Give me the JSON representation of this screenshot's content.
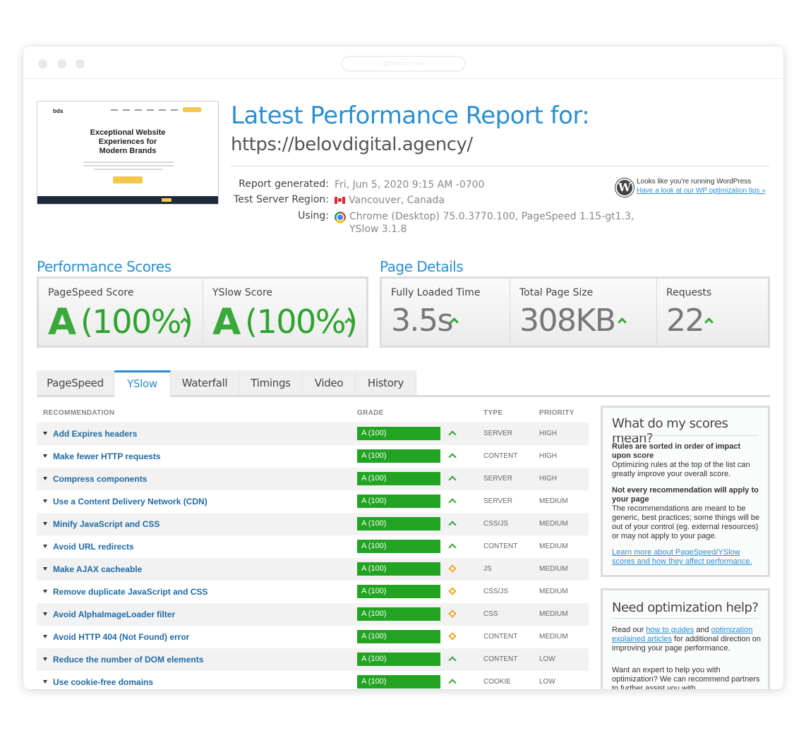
{
  "browser": {
    "url": "gtmetrix.com"
  },
  "thumbnail": {
    "logo": "bda",
    "headline": "Exceptional Website Experiences for Modern Brands"
  },
  "report": {
    "title": "Latest Performance Report for:",
    "url": "https://belovdigital.agency/",
    "generated_label": "Report generated:",
    "generated_value": "Fri, Jun 5, 2020 9:15 AM -0700",
    "region_label": "Test Server Region:",
    "region_value": "Vancouver, Canada",
    "using_label": "Using:",
    "using_value": "Chrome (Desktop) 75.0.3770.100, PageSpeed 1.15-gt1.3,",
    "using_value_2": "YSlow 3.1.8"
  },
  "wordpress": {
    "text": "Looks like you're running WordPress",
    "link": "Have a look at our WP optimization tips »"
  },
  "performance": {
    "title": "Performance Scores",
    "pagespeed": {
      "label": "PageSpeed Score",
      "grade": "A",
      "percent": "(100%)"
    },
    "yslow": {
      "label": "YSlow Score",
      "grade": "A",
      "percent": "(100%)"
    }
  },
  "details": {
    "title": "Page Details",
    "loaded": {
      "label": "Fully Loaded Time",
      "value": "3.5s"
    },
    "size": {
      "label": "Total Page Size",
      "value": "308KB"
    },
    "requests": {
      "label": "Requests",
      "value": "22"
    }
  },
  "tabs": [
    "PageSpeed",
    "YSlow",
    "Waterfall",
    "Timings",
    "Video",
    "History"
  ],
  "table": {
    "headers": {
      "recommendation": "RECOMMENDATION",
      "grade": "GRADE",
      "type": "TYPE",
      "priority": "PRIORITY"
    },
    "rows": [
      {
        "name": "Add Expires headers",
        "grade": "A (100)",
        "trend": "up",
        "type": "SERVER",
        "priority": "HIGH"
      },
      {
        "name": "Make fewer HTTP requests",
        "grade": "A (100)",
        "trend": "up",
        "type": "CONTENT",
        "priority": "HIGH"
      },
      {
        "name": "Compress components",
        "grade": "A (100)",
        "trend": "up",
        "type": "SERVER",
        "priority": "HIGH"
      },
      {
        "name": "Use a Content Delivery Network (CDN)",
        "grade": "A (100)",
        "trend": "up",
        "type": "SERVER",
        "priority": "MEDIUM"
      },
      {
        "name": "Minify JavaScript and CSS",
        "grade": "A (100)",
        "trend": "up",
        "type": "CSS/JS",
        "priority": "MEDIUM"
      },
      {
        "name": "Avoid URL redirects",
        "grade": "A (100)",
        "trend": "up",
        "type": "CONTENT",
        "priority": "MEDIUM"
      },
      {
        "name": "Make AJAX cacheable",
        "grade": "A (100)",
        "trend": "diamond",
        "type": "JS",
        "priority": "MEDIUM"
      },
      {
        "name": "Remove duplicate JavaScript and CSS",
        "grade": "A (100)",
        "trend": "diamond",
        "type": "CSS/JS",
        "priority": "MEDIUM"
      },
      {
        "name": "Avoid AlphaImageLoader filter",
        "grade": "A (100)",
        "trend": "diamond",
        "type": "CSS",
        "priority": "MEDIUM"
      },
      {
        "name": "Avoid HTTP 404 (Not Found) error",
        "grade": "A (100)",
        "trend": "diamond",
        "type": "CONTENT",
        "priority": "MEDIUM"
      },
      {
        "name": "Reduce the number of DOM elements",
        "grade": "A (100)",
        "trend": "up",
        "type": "CONTENT",
        "priority": "LOW"
      },
      {
        "name": "Use cookie-free domains",
        "grade": "A (100)",
        "trend": "up",
        "type": "COOKIE",
        "priority": "LOW"
      }
    ]
  },
  "sidebar": {
    "scores": {
      "title": "What do my scores mean?",
      "p1_head": "Rules are sorted in order of impact upon score",
      "p1_body": "Optimizing rules at the top of the list can greatly improve your overall score.",
      "p2_head": "Not every recommendation will apply to your page",
      "p2_body": "The recommendations are meant to be generic, best practices; some things will be out of your control (eg. external resources) or may not apply to your page.",
      "link": "Learn more about PageSpeed/YSlow scores and how they affect performance."
    },
    "help": {
      "title": "Need optimization help?",
      "p1_a": "Read our ",
      "link1": "how to guides",
      "p1_b": " and ",
      "link2": "optimization explained articles",
      "p1_c": " for additional direction on improving your page performance.",
      "p2": "Want an expert to help you with optimization? We can recommend partners to further assist you with"
    }
  }
}
